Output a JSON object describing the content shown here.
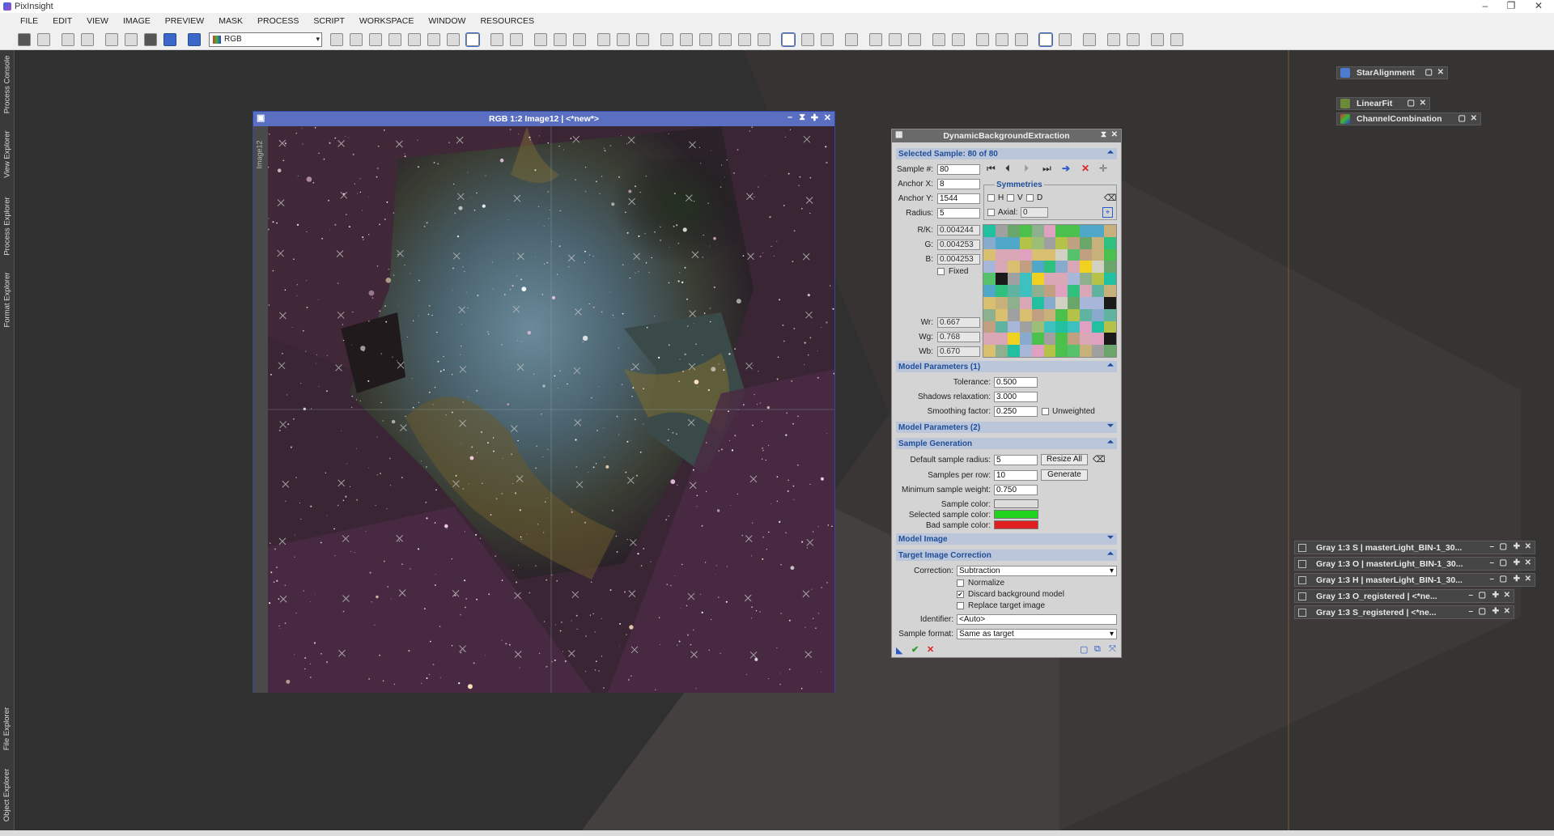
{
  "app": {
    "title": "PixInsight"
  },
  "menu": [
    "FILE",
    "EDIT",
    "VIEW",
    "IMAGE",
    "PREVIEW",
    "MASK",
    "PROCESS",
    "SCRIPT",
    "WORKSPACE",
    "WINDOW",
    "RESOURCES"
  ],
  "toolbar": {
    "channel_select": "RGB"
  },
  "left_dock": {
    "tabs": [
      "Process Console",
      "View Explorer",
      "Process Explorer",
      "Format Explorer",
      "File Explorer",
      "Object Explorer"
    ]
  },
  "image_window": {
    "title": "RGB 1:2 Image12 | <*new*>",
    "side_id": "Image12"
  },
  "process_icons": [
    "StarAlignment",
    "LinearFit",
    "ChannelCombination"
  ],
  "minimized_windows": [
    "Gray 1:3 S | masterLight_BIN-1_30...",
    "Gray 1:3 O | masterLight_BIN-1_30...",
    "Gray 1:3 H | masterLight_BIN-1_30...",
    "Gray 1:3 O_registered | <*ne...",
    "Gray 1:3 S_registered | <*ne..."
  ],
  "dbe": {
    "title": "DynamicBackgroundExtraction",
    "selected_sample_header": "Selected Sample: 80 of 80",
    "sample_label": "Sample #:",
    "sample": "80",
    "anchor_x_label": "Anchor X:",
    "anchor_x": "8",
    "anchor_y_label": "Anchor Y:",
    "anchor_y": "1544",
    "radius_label": "Radius:",
    "radius": "5",
    "symmetries_label": "Symmetries",
    "sym_h": "H",
    "sym_v": "V",
    "sym_d": "D",
    "axial_label": "Axial:",
    "axial": "0",
    "rk_label": "R/K:",
    "rk": "0.004244",
    "g_label": "G:",
    "g": "0.004253",
    "b_label": "B:",
    "b": "0.004253",
    "fixed_label": "Fixed",
    "wr_label": "Wr:",
    "wr": "0.667",
    "wg_label": "Wg:",
    "wg": "0.768",
    "wb_label": "Wb:",
    "wb": "0.670",
    "model_params1": "Model Parameters (1)",
    "tolerance_label": "Tolerance:",
    "tolerance": "0.500",
    "shadows_label": "Shadows relaxation:",
    "shadows": "3.000",
    "smoothing_label": "Smoothing factor:",
    "smoothing": "0.250",
    "unweighted_label": "Unweighted",
    "model_params2": "Model Parameters (2)",
    "sample_generation": "Sample Generation",
    "default_radius_label": "Default sample radius:",
    "default_radius": "5",
    "resize_all": "Resize All",
    "samples_per_row_label": "Samples per row:",
    "samples_per_row": "10",
    "generate": "Generate",
    "min_weight_label": "Minimum sample weight:",
    "min_weight": "0.750",
    "sample_color_label": "Sample color:",
    "selected_color_label": "Selected sample color:",
    "bad_color_label": "Bad sample color:",
    "model_image": "Model Image",
    "target_correction": "Target Image Correction",
    "correction_label": "Correction:",
    "correction": "Subtraction",
    "normalize_label": "Normalize",
    "discard_label": "Discard background model",
    "replace_label": "Replace target image",
    "identifier_label": "Identifier:",
    "identifier": "<Auto>",
    "sample_format_label": "Sample format:",
    "sample_format": "Same as target"
  },
  "colors": {
    "accent": "#5b6fc2",
    "section_text": "#1e4e9a",
    "selected_sample": "#1fd31f",
    "bad_sample": "#e02020",
    "sample_color": "#dcdcdc"
  }
}
